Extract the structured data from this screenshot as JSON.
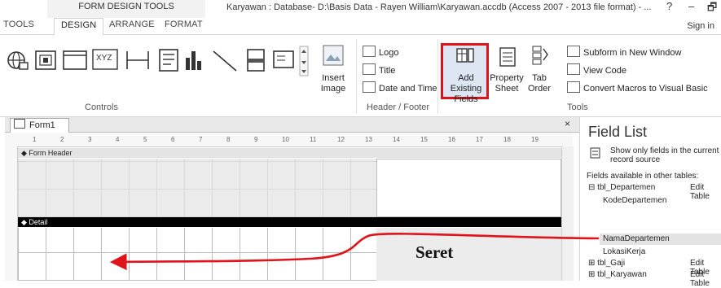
{
  "window": {
    "title": "Karyawan : Database- D:\\Basis Data - Rayen William\\Karyawan.accdb (Access 2007 - 2013 file format) - ...",
    "help": "?",
    "minimize": "–",
    "restore": "🗗"
  },
  "contextual_group": "FORM DESIGN TOOLS",
  "tabs": [
    "TOOLS",
    "DESIGN",
    "ARRANGE",
    "FORMAT"
  ],
  "sign_in": "Sign in",
  "ribbon": {
    "controls_label": "Controls",
    "insert_image": "Insert\nImage",
    "header_footer": {
      "label": "Header / Footer",
      "logo": "Logo",
      "title": "Title",
      "date_time": "Date and Time"
    },
    "tools": {
      "label": "Tools",
      "add_existing_fields": "Add Existing\nFields",
      "property_sheet": "Property\nSheet",
      "tab_order": "Tab\nOrder",
      "subform_new_window": "Subform in New Window",
      "view_code": "View Code",
      "convert_macros": "Convert Macros to Visual Basic"
    }
  },
  "document": {
    "tab_label": "Form1",
    "close": "×",
    "ruler_numbers": [
      "1",
      "2",
      "3",
      "4",
      "5",
      "6",
      "7",
      "8",
      "9",
      "10",
      "11",
      "12",
      "13",
      "14",
      "15",
      "16",
      "17",
      "18",
      "19"
    ],
    "form_header": "Form Header",
    "detail": "Detail",
    "annotation": "Seret"
  },
  "field_list": {
    "title": "Field List",
    "show_only": "Show only fields in the current",
    "record_source": "record source",
    "available_label": "Fields available in other tables:",
    "edit_table": "Edit Table",
    "tables": [
      {
        "name": "tbl_Departemen",
        "expand": "⊟",
        "fields": [
          "KodeDepartemen",
          "NamaDepartemen",
          "LokasiKerja"
        ]
      },
      {
        "name": "tbl_Gaji",
        "expand": "⊞",
        "fields": []
      },
      {
        "name": "tbl_Karyawan",
        "expand": "⊞",
        "fields": []
      }
    ]
  },
  "colors": {
    "highlight_border": "#e0131b",
    "arrow": "#e0131b",
    "detail_bar": "#000000"
  }
}
